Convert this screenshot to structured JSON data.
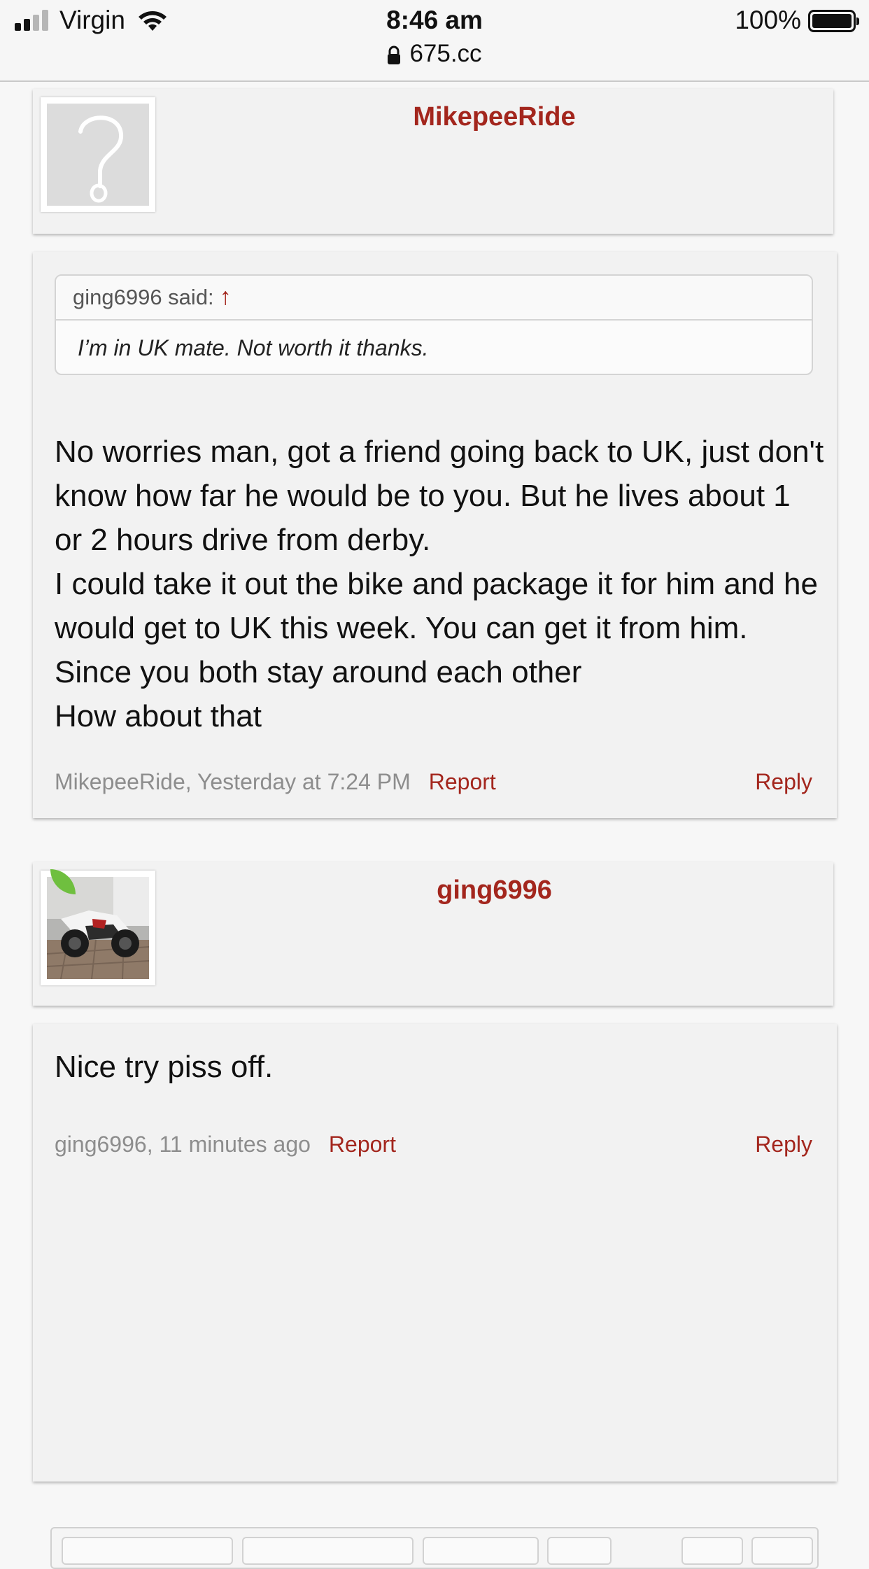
{
  "status_bar": {
    "carrier": "Virgin",
    "time": "8:46 am",
    "url": "675.cc",
    "battery": "100%"
  },
  "posts": [
    {
      "username": "MikepeeRide",
      "avatar": "question-mark-placeholder",
      "quote": {
        "author": "ging6996 said:",
        "arrow": "↑",
        "text": "I’m in UK mate. Not worth it thanks."
      },
      "lines": [
        "No worries man, got a friend going back to UK, just don't know how far he would be to you. But he lives about 1 or 2 hours drive from derby.",
        "I could take it out the bike and package it for him and he would get to UK this week. You can get it from him.",
        "Since you both stay around each other",
        "How about that"
      ],
      "meta": "MikepeeRide, Yesterday at 7:24 PM",
      "report": "Report",
      "reply": "Reply"
    },
    {
      "username": "ging6996",
      "avatar": "motorcycle-photo",
      "lines": [
        "Nice try piss off."
      ],
      "meta": "ging6996, 11 minutes ago",
      "report": "Report",
      "reply": "Reply"
    }
  ],
  "colors": {
    "accent": "#a3261d",
    "meta": "#8d8d8d",
    "card": "#f2f2f2"
  }
}
